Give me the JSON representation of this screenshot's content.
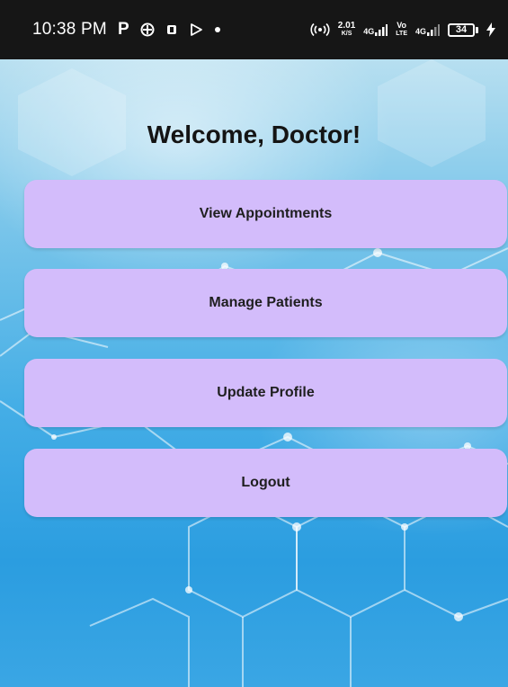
{
  "status_bar": {
    "time": "10:38 PM",
    "left_icons": [
      "p-app-icon",
      "cross-circle-icon",
      "film-icon",
      "play-icon",
      "dot-icon"
    ],
    "speed_value": "2.01",
    "speed_unit": "K/S",
    "net1": "4G",
    "volte_top": "Vo",
    "volte_bottom": "LTE",
    "net2": "4G",
    "battery": "34"
  },
  "main": {
    "title": "Welcome, Doctor!",
    "buttons": [
      {
        "label": "View Appointments"
      },
      {
        "label": "Manage Patients"
      },
      {
        "label": "Update Profile"
      },
      {
        "label": "Logout"
      }
    ]
  },
  "colors": {
    "button_bg": "#d3bcfb",
    "status_bar_bg": "#161616",
    "background_blue": "#45aee6"
  }
}
